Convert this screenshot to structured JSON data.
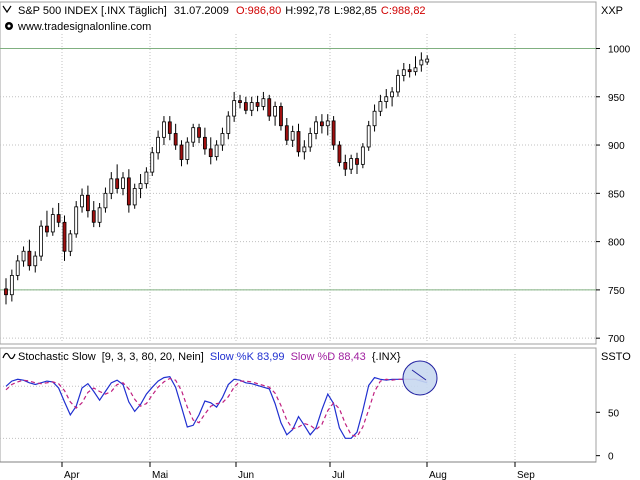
{
  "header": {
    "instrument": "S&P 500 INDEX [.INX  Täglich]",
    "date": "31.07.2009",
    "open": "O:986,80",
    "high": "H:992,78",
    "low": "L:982,85",
    "close": "C:988,82",
    "source": "www.tradesignalonline.com",
    "axis_code_price": "XXP",
    "axis_code_osc": "SSTO"
  },
  "indicator": {
    "name": "Stochastic Slow",
    "params": "[9, 3, 3, 80, 20, Nein]",
    "k_label": "Slow %K 83,99",
    "d_label": "Slow %D 88,43",
    "symbol": "{.INX}"
  },
  "colors": {
    "up": "#ffffff",
    "down": "#a01010",
    "grid": "#c0c0c0",
    "ref_line": "#80b080",
    "k_line": "#2030d0",
    "d_line": "#c02080",
    "header_red": "#d00000",
    "circle_fill": "#c8d8f0",
    "circle_stroke": "#2020a0"
  },
  "chart_data": [
    {
      "type": "candlestick",
      "ylim": [
        695,
        1015
      ],
      "yticks": [
        700,
        750,
        800,
        850,
        900,
        950,
        1000
      ],
      "ref_lines": [
        750,
        1000
      ],
      "xticks": [
        "Apr",
        "Mai",
        "Jun",
        "Jul",
        "Aug",
        "Sep"
      ],
      "grid": true,
      "ohlc": [
        [
          751,
          762,
          735,
          745
        ],
        [
          745,
          771,
          738,
          765
        ],
        [
          765,
          786,
          760,
          780
        ],
        [
          780,
          795,
          774,
          790
        ],
        [
          790,
          802,
          770,
          775
        ],
        [
          775,
          790,
          768,
          785
        ],
        [
          785,
          822,
          780,
          816
        ],
        [
          816,
          832,
          805,
          810
        ],
        [
          810,
          835,
          806,
          828
        ],
        [
          828,
          840,
          815,
          820
        ],
        [
          820,
          827,
          780,
          790
        ],
        [
          790,
          812,
          785,
          808
        ],
        [
          808,
          842,
          804,
          836
        ],
        [
          836,
          855,
          830,
          848
        ],
        [
          848,
          858,
          825,
          832
        ],
        [
          832,
          842,
          815,
          820
        ],
        [
          820,
          840,
          815,
          835
        ],
        [
          835,
          856,
          830,
          850
        ],
        [
          850,
          872,
          844,
          865
        ],
        [
          865,
          880,
          850,
          855
        ],
        [
          855,
          872,
          848,
          866
        ],
        [
          866,
          875,
          830,
          838
        ],
        [
          838,
          860,
          834,
          855
        ],
        [
          855,
          870,
          845,
          860
        ],
        [
          860,
          877,
          855,
          872
        ],
        [
          872,
          898,
          868,
          892
        ],
        [
          892,
          915,
          885,
          908
        ],
        [
          908,
          930,
          900,
          924
        ],
        [
          924,
          930,
          905,
          912
        ],
        [
          912,
          922,
          895,
          900
        ],
        [
          900,
          905,
          878,
          885
        ],
        [
          885,
          908,
          880,
          903
        ],
        [
          903,
          922,
          898,
          918
        ],
        [
          918,
          922,
          902,
          908
        ],
        [
          908,
          918,
          890,
          896
        ],
        [
          896,
          908,
          880,
          888
        ],
        [
          888,
          905,
          884,
          900
        ],
        [
          900,
          918,
          894,
          912
        ],
        [
          912,
          935,
          906,
          930
        ],
        [
          930,
          955,
          924,
          946
        ],
        [
          946,
          952,
          938,
          944
        ],
        [
          944,
          950,
          932,
          936
        ],
        [
          936,
          950,
          930,
          944
        ],
        [
          944,
          951,
          935,
          940
        ],
        [
          940,
          955,
          936,
          948
        ],
        [
          948,
          952,
          925,
          930
        ],
        [
          930,
          945,
          920,
          940
        ],
        [
          940,
          944,
          915,
          920
        ],
        [
          920,
          928,
          900,
          905
        ],
        [
          905,
          920,
          898,
          914
        ],
        [
          914,
          922,
          888,
          893
        ],
        [
          893,
          905,
          885,
          898
        ],
        [
          898,
          918,
          893,
          912
        ],
        [
          912,
          930,
          906,
          924
        ],
        [
          924,
          932,
          912,
          920
        ],
        [
          920,
          932,
          910,
          925
        ],
        [
          925,
          930,
          895,
          900
        ],
        [
          900,
          904,
          878,
          882
        ],
        [
          882,
          890,
          868,
          875
        ],
        [
          875,
          890,
          870,
          886
        ],
        [
          886,
          892,
          870,
          880
        ],
        [
          880,
          902,
          876,
          898
        ],
        [
          898,
          925,
          894,
          920
        ],
        [
          920,
          942,
          914,
          935
        ],
        [
          935,
          952,
          930,
          945
        ],
        [
          945,
          958,
          938,
          950
        ],
        [
          950,
          960,
          940,
          955
        ],
        [
          955,
          978,
          950,
          972
        ],
        [
          972,
          985,
          966,
          978
        ],
        [
          978,
          984,
          970,
          976
        ],
        [
          976,
          992,
          972,
          980
        ],
        [
          983,
          996,
          976,
          988
        ],
        [
          986,
          993,
          983,
          989
        ]
      ]
    },
    {
      "type": "line",
      "title": "Stochastic Slow",
      "ylim": [
        -5,
        108
      ],
      "yticks": [
        0,
        50
      ],
      "ref_lines": [
        20,
        80
      ],
      "series": [
        {
          "name": "Slow %K",
          "values": [
            80,
            86,
            88,
            87,
            84,
            82,
            84,
            86,
            85,
            78,
            62,
            47,
            57,
            78,
            83,
            74,
            64,
            74,
            84,
            87,
            82,
            62,
            51,
            59,
            71,
            79,
            86,
            90,
            91,
            79,
            56,
            33,
            35,
            47,
            63,
            61,
            56,
            67,
            82,
            88,
            87,
            84,
            83,
            81,
            79,
            77,
            60,
            38,
            24,
            30,
            45,
            35,
            24,
            32,
            53,
            71,
            60,
            32,
            20,
            20,
            27,
            52,
            81,
            90,
            88,
            87,
            88,
            88,
            88,
            88,
            88,
            86,
            84
          ]
        },
        {
          "name": "Slow %D",
          "values": [
            76,
            82,
            85,
            87,
            86,
            84,
            83,
            84,
            85,
            83,
            75,
            62,
            55,
            61,
            73,
            78,
            74,
            71,
            74,
            82,
            84,
            77,
            65,
            57,
            60,
            70,
            79,
            85,
            89,
            87,
            75,
            56,
            41,
            38,
            48,
            57,
            60,
            61,
            68,
            79,
            86,
            86,
            85,
            83,
            81,
            79,
            72,
            58,
            41,
            31,
            33,
            37,
            35,
            30,
            36,
            52,
            61,
            54,
            37,
            24,
            22,
            33,
            53,
            74,
            86,
            88,
            87,
            88,
            88,
            88,
            88,
            88,
            86
          ]
        }
      ]
    }
  ]
}
